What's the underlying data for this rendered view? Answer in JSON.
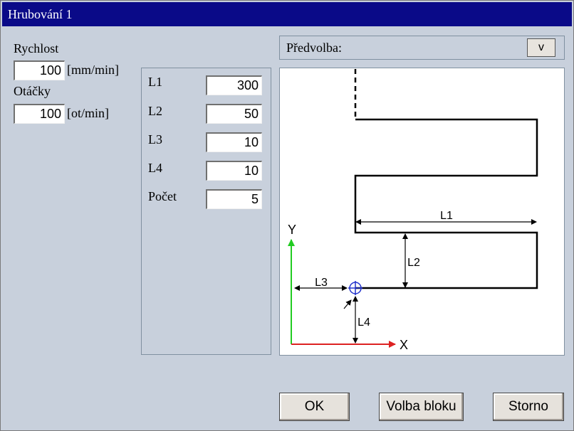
{
  "window": {
    "title": "Hrubování 1"
  },
  "speed": {
    "label": "Rychlost",
    "value": "100",
    "unit": "[mm/min]"
  },
  "rpm": {
    "label": "Otáčky",
    "value": "100",
    "unit": "[ot/min]"
  },
  "params": [
    {
      "label": "L1",
      "value": "300"
    },
    {
      "label": "L2",
      "value": "50"
    },
    {
      "label": "L3",
      "value": "10"
    },
    {
      "label": "L4",
      "value": "10"
    },
    {
      "label": "Počet",
      "value": "5"
    }
  ],
  "preset": {
    "label": "Předvolba:",
    "dropdown_label": "v"
  },
  "diagram": {
    "axis_y": "Y",
    "axis_x": "X",
    "dim_l1": "L1",
    "dim_l2": "L2",
    "dim_l3": "L3",
    "dim_l4": "L4",
    "colors": {
      "y_axis": "#22cc22",
      "x_axis": "#dd2222",
      "origin": "#2233cc"
    }
  },
  "buttons": {
    "ok": "OK",
    "block": "Volba bloku",
    "cancel": "Storno"
  }
}
